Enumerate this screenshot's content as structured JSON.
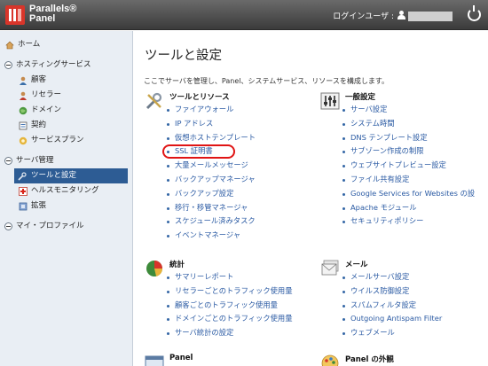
{
  "header": {
    "brand_line1": "Parallels®",
    "brand_line2": "Panel",
    "login_label": "ログインユーザ :"
  },
  "sidebar": {
    "home": "ホーム",
    "hosting_section": "ホスティングサービス",
    "hosting_items": [
      "顧客",
      "リセラー",
      "ドメイン",
      "契約",
      "サービスプラン"
    ],
    "server_section": "サーバ管理",
    "server_items": [
      "ツールと設定",
      "ヘルスモニタリング",
      "拡張"
    ],
    "profile_section": "マイ・プロファイル"
  },
  "main": {
    "title": "ツールと設定",
    "description": "ここでサーバを管理し、Panel、システムサービス、リソースを構成します。",
    "groups": {
      "tools": {
        "title": "ツールとリソース",
        "links": [
          "ファイアウォール",
          "IP アドレス",
          "仮想ホストテンプレート",
          "SSL 証明書",
          "大量メールメッセージ",
          "バックアップマネージャ",
          "バックアップ設定",
          "移行・移管マネージャ",
          "スケジュール済みタスク",
          "イベントマネージャ"
        ]
      },
      "general": {
        "title": "一般設定",
        "links": [
          "サーバ設定",
          "システム時間",
          "DNS テンプレート設定",
          "サブゾーン作成の制限",
          "ウェブサイトプレビュー設定",
          "ファイル共有設定",
          "Google Services for Websites の設",
          "Apache モジュール",
          "セキュリティポリシー"
        ]
      },
      "stats": {
        "title": "統計",
        "links": [
          "サマリーレポート",
          "リセラーごとのトラフィック使用量",
          "顧客ごとのトラフィック使用量",
          "ドメインごとのトラフィック使用量",
          "サーバ統計の設定"
        ]
      },
      "mail": {
        "title": "メール",
        "links": [
          "メールサーバ設定",
          "ウイルス防御設定",
          "スパムフィルタ設定",
          "Outgoing Antispam Filter",
          "ウェブメール"
        ]
      },
      "panel": {
        "title": "Panel"
      },
      "appearance": {
        "title": "Panel の外観"
      }
    }
  },
  "colors": {
    "link": "#2a5aa3",
    "active_nav": "#2d5c94",
    "highlight": "#e01414"
  }
}
